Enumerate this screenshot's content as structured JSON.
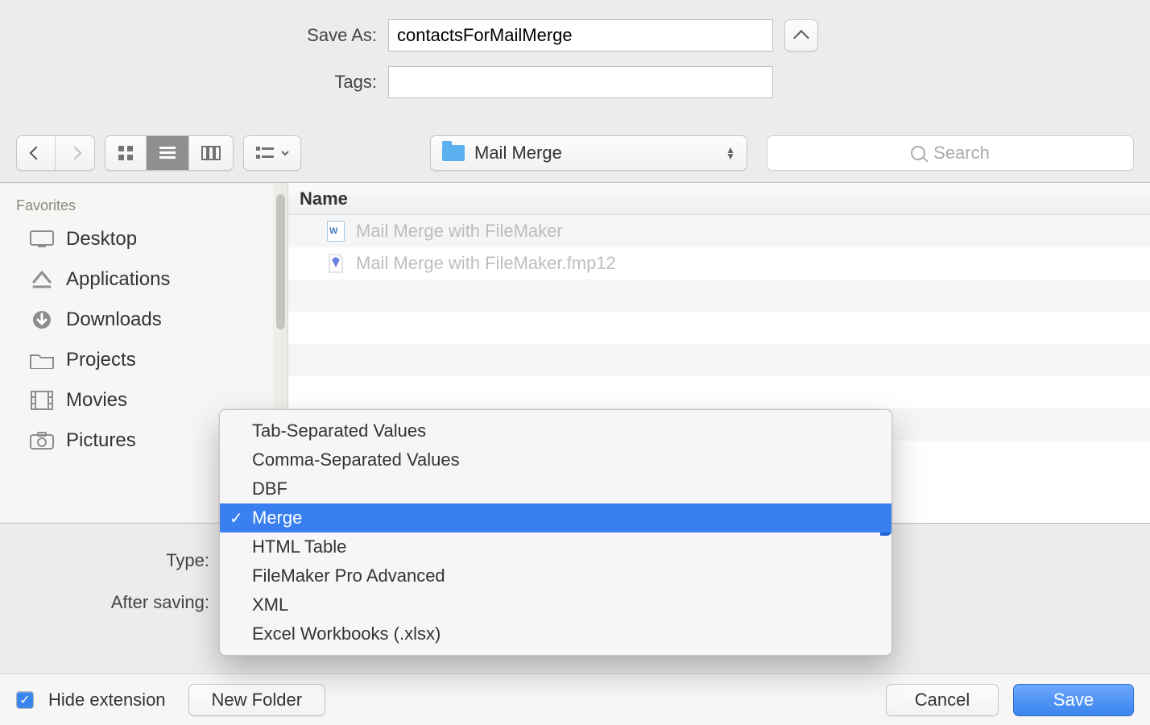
{
  "labels": {
    "save_as": "Save As:",
    "tags": "Tags:",
    "type": "Type:",
    "after_saving": "After saving:"
  },
  "save_as_value": "contactsForMailMerge",
  "tags_value": "",
  "current_folder": "Mail Merge",
  "search_placeholder": "Search",
  "sidebar": {
    "heading": "Favorites",
    "items": [
      {
        "label": "Desktop"
      },
      {
        "label": "Applications"
      },
      {
        "label": "Downloads"
      },
      {
        "label": "Projects"
      },
      {
        "label": "Movies"
      },
      {
        "label": "Pictures"
      }
    ]
  },
  "list_header": "Name",
  "files": [
    {
      "name": "Mail Merge with FileMaker",
      "kind": "word"
    },
    {
      "name": "Mail Merge with FileMaker.fmp12",
      "kind": "fmp"
    }
  ],
  "type_menu": {
    "options": [
      "Tab-Separated Values",
      "Comma-Separated Values",
      "DBF",
      "Merge",
      "HTML Table",
      "FileMaker Pro Advanced",
      "XML",
      "Excel Workbooks (.xlsx)"
    ],
    "selected_index": 3
  },
  "footer": {
    "hide_extension": "Hide extension",
    "new_folder": "New Folder",
    "cancel": "Cancel",
    "save": "Save",
    "hide_extension_checked": true
  }
}
